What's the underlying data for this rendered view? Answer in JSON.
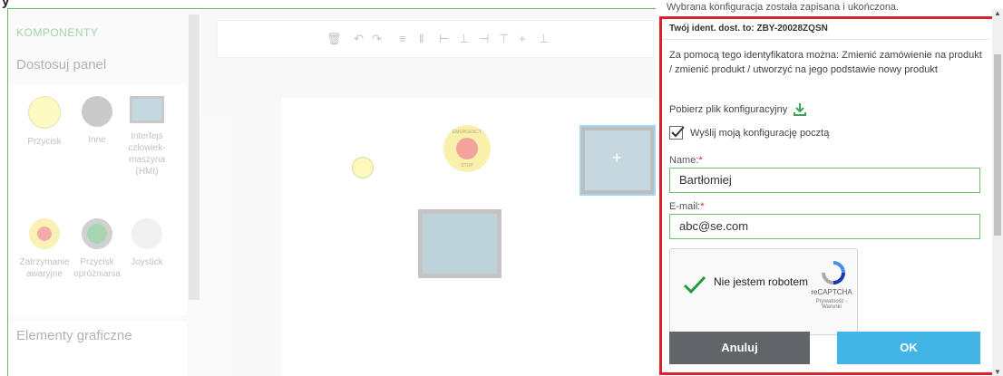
{
  "page": {
    "title": "y",
    "above_dialog_text": "Wybrana konfiguracja została zapisana i ukończona."
  },
  "left_panel": {
    "section_label": "KOMPONENTY",
    "panel_title": "Dostosuj panel",
    "components": [
      {
        "label": "Przycisk",
        "icon": "yellow-button-icon",
        "color": "#fff67a"
      },
      {
        "label": "Inne",
        "icon": "gray-button-icon",
        "color": "#8c8c8c"
      },
      {
        "label": "Interfejs człowiek-maszyna (HMI)",
        "icon": "hmi-icon",
        "color": "#5b8fa8"
      },
      {
        "label": "Zatrzymanie awaryjne",
        "icon": "emergency-stop-icon",
        "color": "#e74c3c"
      },
      {
        "label": "Przycisk opróżniania",
        "icon": "green-button-icon",
        "color": "#3aa655"
      },
      {
        "label": "Joystick",
        "icon": "joystick-icon",
        "color": "#d0d0d0"
      }
    ],
    "graphic_elements_title": "Elementy graficzne"
  },
  "canvas": {
    "emergency_labels": {
      "top": "EMERGENCY",
      "bottom": "STOP"
    }
  },
  "dialog": {
    "ident_text": "Twój ident. dost. to: ZBY-20028ZQSN",
    "description": "Za pomocą tego identyfikatora można: Zmienić zamówienie na produkt / zmienić produkt / utworzyć na jego podstawie nowy produkt",
    "download_label": "Pobierz plik konfiguracyjny",
    "email_checkbox_label": "Wyślij moją konfigurację pocztą",
    "email_checkbox_checked": true,
    "name_label": "Name:",
    "name_value": "Bartłomiej",
    "email_label": "E-mail:",
    "email_value": "abc@se.com",
    "required_marker": "*",
    "captcha": {
      "label": "Nie jestem robotem",
      "brand": "reCAPTCHA",
      "links": "Prywatność - Warunki"
    },
    "cancel_label": "Anuluj",
    "ok_label": "OK",
    "accent_color": "#42b4e6",
    "highlight_border_color": "#d9232a"
  }
}
